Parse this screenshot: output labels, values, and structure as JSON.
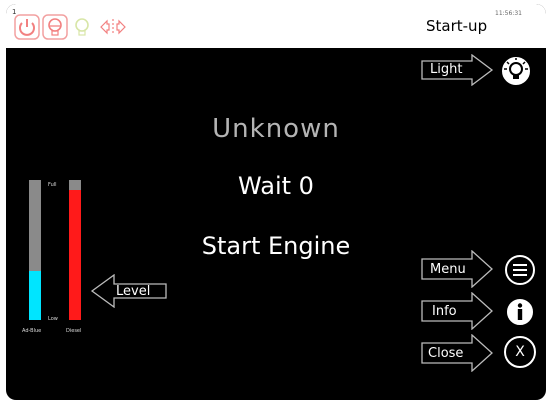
{
  "topbar": {
    "corner_number": "1",
    "mode_title": "Start-up",
    "clock": "11:56:31",
    "status_icons": [
      "power-icon",
      "bulb-icon",
      "bulb-dim-icon",
      "signal-arrows-icon"
    ]
  },
  "main": {
    "status": "Unknown",
    "wait": "Wait 0",
    "instruction": "Start Engine"
  },
  "buttons": {
    "light": "Light",
    "menu": "Menu",
    "info": "Info",
    "close": "Close",
    "close_glyph": "X",
    "level": "Level"
  },
  "gauges": {
    "full_label": "Full",
    "low_label": "Low",
    "adblue_label": "Ad-Blue",
    "diesel_label": "Diesel",
    "adblue_level": 0.35,
    "diesel_level": 0.93,
    "adblue_color": "#00e5ff",
    "diesel_color": "#ff1a1a"
  }
}
